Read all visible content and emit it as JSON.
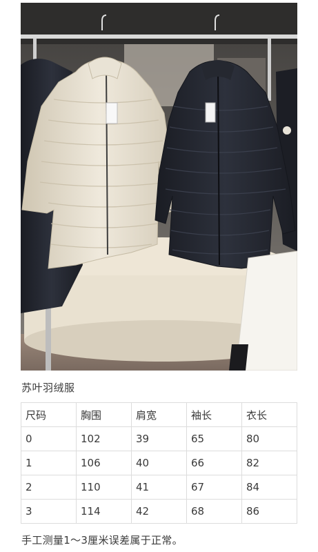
{
  "product": {
    "title": "苏叶羽绒服",
    "image_alt": "cream and black long down jackets on hangers"
  },
  "size_table": {
    "headers": [
      "尺码",
      "胸围",
      "肩宽",
      "袖长",
      "衣长"
    ],
    "rows": [
      [
        "0",
        "102",
        "39",
        "65",
        "80"
      ],
      [
        "1",
        "106",
        "40",
        "66",
        "82"
      ],
      [
        "2",
        "110",
        "41",
        "67",
        "84"
      ],
      [
        "3",
        "114",
        "42",
        "68",
        "86"
      ]
    ]
  },
  "note": "手工测量1～3厘米误差属于正常。",
  "colors": {
    "cream_jacket": "#e6dfcf",
    "navy_jacket": "#23262f",
    "table_border": "#dcdcdc",
    "text": "#3a3a3a"
  }
}
